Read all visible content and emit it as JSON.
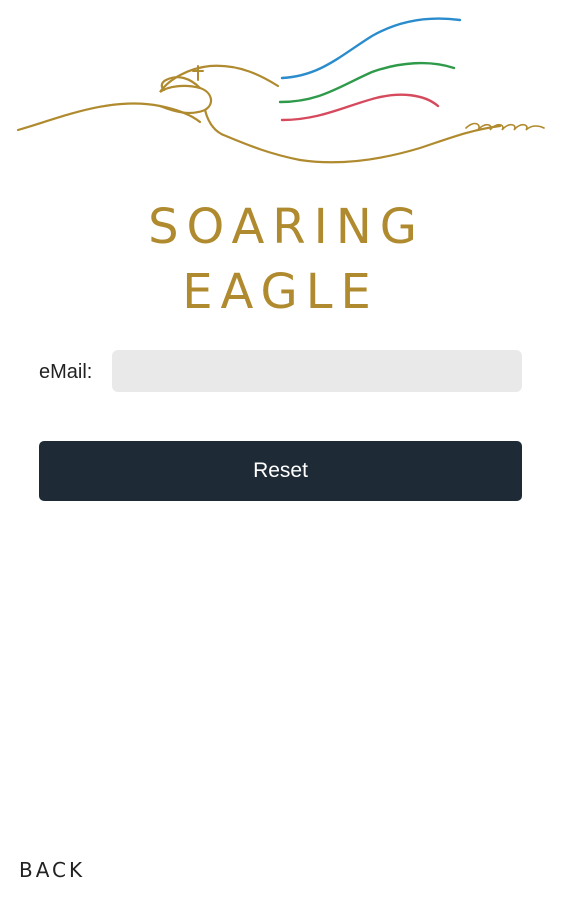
{
  "brand": {
    "name_line1": "SOARING",
    "name_line2": "EAGLE",
    "color_gold": "#b08a2e",
    "color_blue": "#2a8ccc",
    "color_green": "#2e9a4a",
    "color_red": "#d64a5e"
  },
  "logo": {
    "icon": "eagle-logo-icon"
  },
  "form": {
    "email_label": "eMail:",
    "email_value": "",
    "email_placeholder": "",
    "reset_label": "Reset",
    "button_color": "#1e2b37"
  },
  "footer": {
    "back_label": "BACK"
  }
}
